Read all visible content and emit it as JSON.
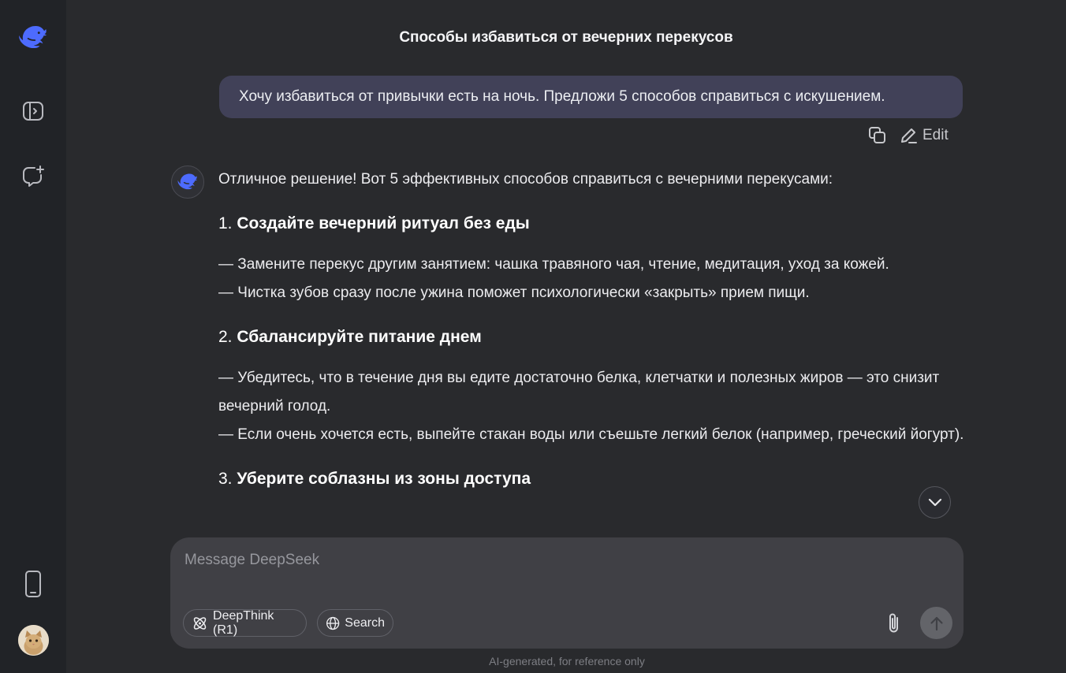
{
  "chat": {
    "title": "Способы избавиться от вечерних перекусов",
    "user_message": "Хочу избавиться от привычки есть на ночь. Предложи 5 способов справиться с искушением.",
    "edit_label": "Edit"
  },
  "answer": {
    "intro": "Отличное решение! Вот 5 эффективных способов справиться с вечерними перекусами:",
    "sections": [
      {
        "num": "1.",
        "title": "Создайте вечерний ритуал без еды",
        "lines": [
          "— Замените перекус другим занятием: чашка травяного чая, чтение, медитация, уход за кожей.",
          "— Чистка зубов сразу после ужина поможет психологически «закрыть» прием пищи."
        ]
      },
      {
        "num": "2.",
        "title": "Сбалансируйте питание днем",
        "lines": [
          "— Убедитесь, что в течение дня вы едите достаточно белка, клетчатки и полезных жиров — это снизит вечерний голод.",
          "— Если очень хочется есть, выпейте стакан воды или съешьте легкий белок (например, греческий йогурт)."
        ]
      },
      {
        "num": "3.",
        "title": "Уберите соблазны из зоны доступа",
        "lines": []
      }
    ]
  },
  "composer": {
    "placeholder": "Message DeepSeek",
    "deepthink_label": "DeepThink (R1)",
    "search_label": "Search"
  },
  "footer": {
    "disclaimer": "AI-generated, for reference only"
  },
  "icons": {
    "logo": "deepseek-whale-icon",
    "sidebar_toggle": "sidebar-open-icon",
    "new_chat": "new-chat-icon",
    "phone": "phone-icon",
    "copy": "copy-icon",
    "edit": "pencil-icon",
    "scroll": "chevron-down-icon",
    "deepthink": "atom-icon",
    "search": "globe-icon",
    "attach": "paperclip-icon",
    "send": "arrow-up-icon"
  },
  "colors": {
    "accent": "#4d6bfe",
    "background": "#292a2d",
    "sidebar": "#212327",
    "user_bubble": "#414158",
    "composer": "#404045"
  }
}
